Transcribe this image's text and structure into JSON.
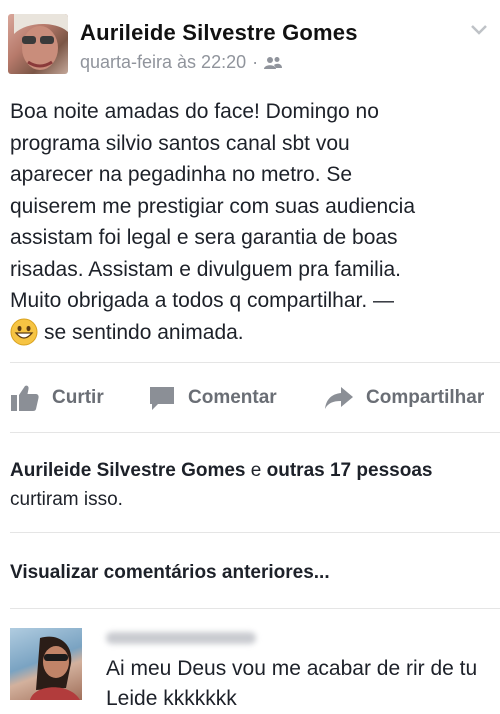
{
  "post": {
    "author": "Aurileide Silvestre Gomes",
    "timestamp": "quarta-feira às 22:20",
    "separator": "·",
    "audience_icon": "friends-icon",
    "text_lines": [
      "Boa noite amadas do face! Domingo no",
      "programa silvio santos canal sbt vou",
      "aparecer na pegadinha no metro. Se",
      "quiserem me prestigiar com suas audiencia",
      "assistam foi legal e sera garantia de boas",
      "risadas. Assistam  e divulguem pra familia.",
      "Muito obrigada a todos q compartilhar. —"
    ],
    "feeling_icon": "grinning-emoji-icon",
    "feeling": "se sentindo animada."
  },
  "actions": {
    "like": "Curtir",
    "comment": "Comentar",
    "share": "Compartilhar"
  },
  "likes": {
    "first_name": "Aurileide Silvestre Gomes",
    "conjunction": "e",
    "others": "outras 17",
    "others_2": "pessoas",
    "suffix": "curtiram isso."
  },
  "comments": {
    "view_previous": "Visualizar comentários anteriores...",
    "items": [
      {
        "text": "Ai meu Deus vou me acabar de rir de tu Leide kkkkkkk"
      }
    ]
  },
  "colors": {
    "meta": "#90949c",
    "action": "#6a6e75",
    "divider": "#e5e5e5",
    "emoji": "#f6c443"
  }
}
